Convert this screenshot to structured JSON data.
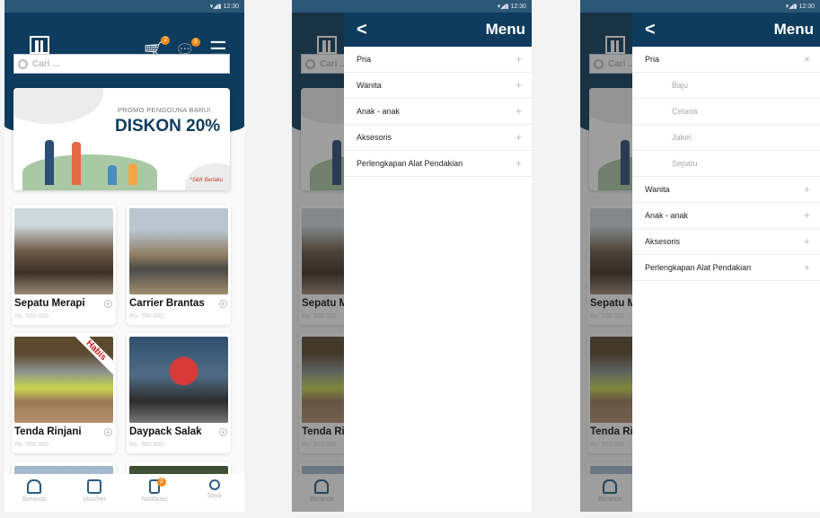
{
  "status": {
    "time": "12:30"
  },
  "header": {
    "cart_badge": "2",
    "chat_badge": "3"
  },
  "search": {
    "placeholder": "Cari ..."
  },
  "banner": {
    "promo": "PROMO PENGGUNA BARU!",
    "headline": "DISKON 20%",
    "terms": "*S&K Berlaku"
  },
  "products": [
    {
      "name": "Sepatu Merapi",
      "price": "Rp. 500.000"
    },
    {
      "name": "Carrier Brantas",
      "price": "Rp. 750.000"
    },
    {
      "name": "Tenda Rinjani",
      "price": "Rp. 950.000",
      "badge": "Habis"
    },
    {
      "name": "Daypack Salak",
      "price": "Rp. 380.000"
    }
  ],
  "nav": [
    {
      "label": "Beranda"
    },
    {
      "label": "Voucher"
    },
    {
      "label": "Notifikasi",
      "badge": "2"
    },
    {
      "label": "Saya"
    }
  ],
  "menu": {
    "title": "Menu",
    "back": "<",
    "expand": "+",
    "collapse": "×",
    "items": [
      {
        "label": "Pria"
      },
      {
        "label": "Wanita"
      },
      {
        "label": "Anak - anak"
      },
      {
        "label": "Aksesoris"
      },
      {
        "label": "Perlengkapan Alat Pendakian"
      }
    ],
    "pria_sub": [
      {
        "label": "Baju"
      },
      {
        "label": "Celana"
      },
      {
        "label": "Jaket"
      },
      {
        "label": "Sepatu"
      }
    ]
  }
}
